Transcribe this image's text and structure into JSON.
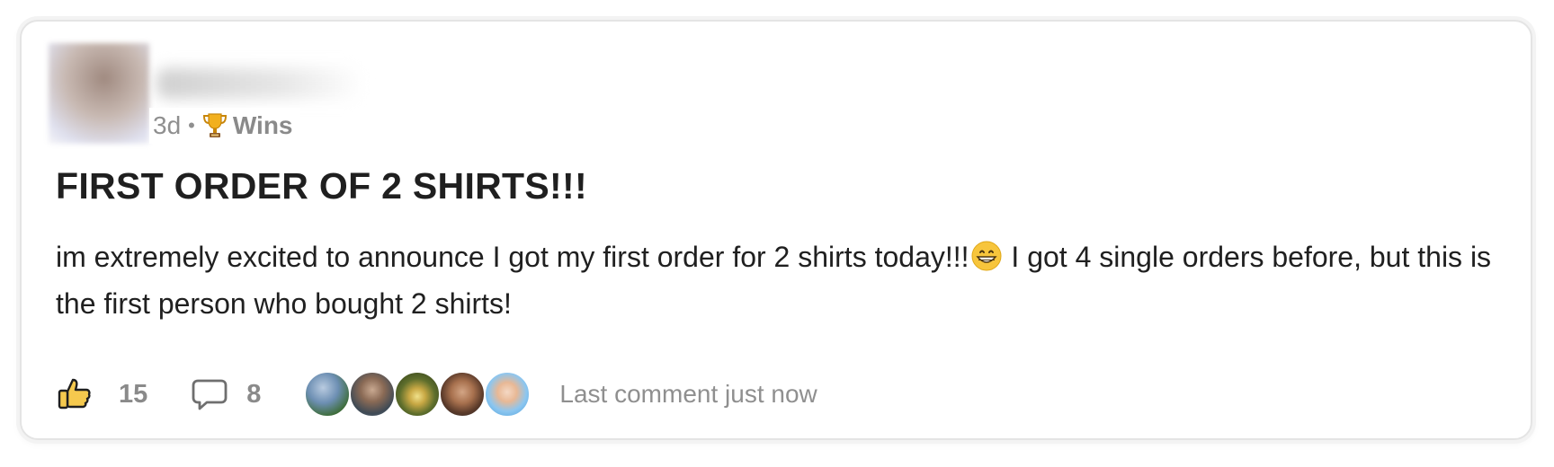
{
  "post": {
    "age": "3d",
    "separator": "•",
    "category": "Wins",
    "category_icon": "trophy-icon",
    "title": "FIRST ORDER OF 2 SHIRTS!!!",
    "body_part1": "im extremely excited to announce I got my first order for 2 shirts today!!!",
    "body_emoji": "grinning-face-emoji",
    "body_part2": " I got 4 single orders before, but this is the first person who bought 2 shirts!"
  },
  "footer": {
    "like_icon": "thumbs-up-icon",
    "like_count": "15",
    "comment_icon": "comment-bubble-icon",
    "comment_count": "8",
    "commenter_avatars": 5,
    "last_comment": "Last comment just now"
  },
  "colors": {
    "text_primary": "#1f1f1f",
    "text_muted": "#8f8f8f",
    "like_accent": "#f5c94e",
    "border": "#e4e4e4"
  }
}
